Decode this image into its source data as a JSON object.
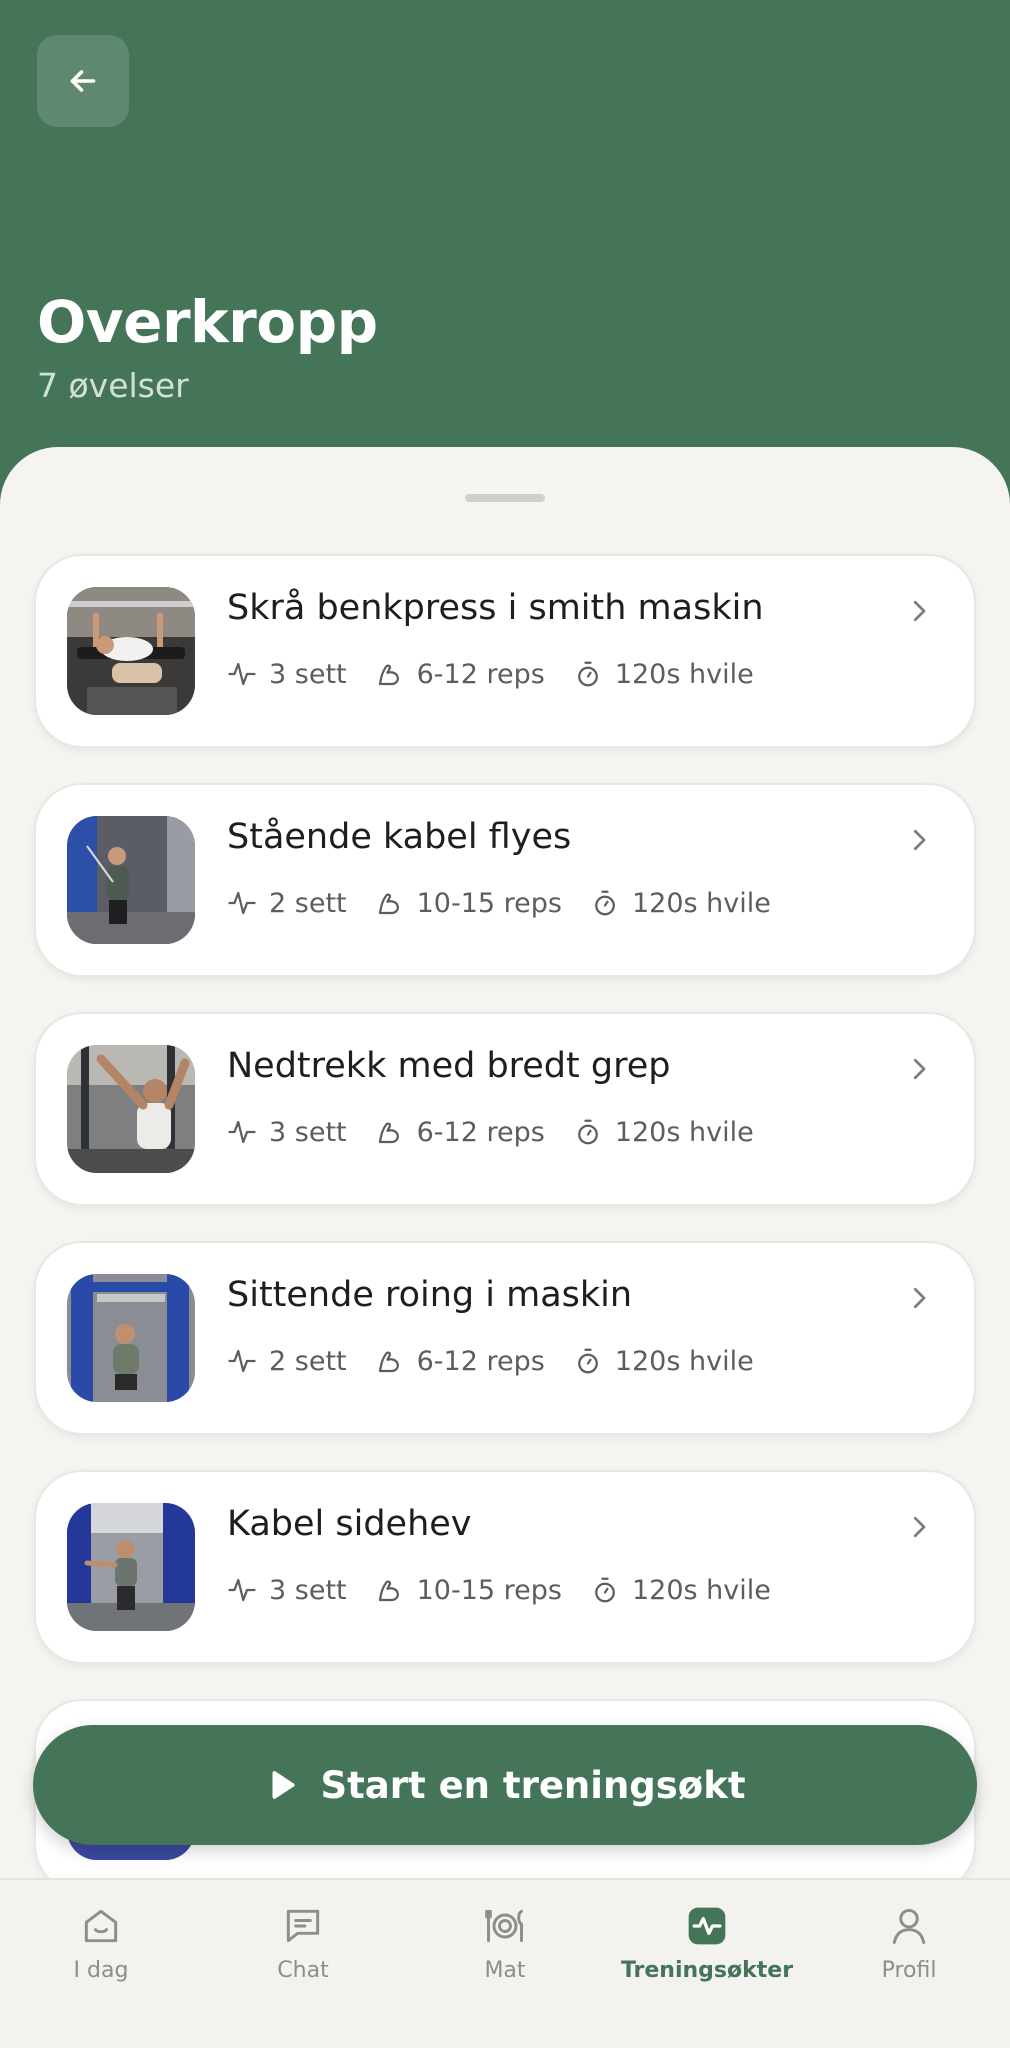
{
  "header": {
    "title": "Overkropp",
    "subtitle": "7 øvelser"
  },
  "exercises": [
    {
      "name": "Skrå benkpress i smith maskin",
      "sets": "3 sett",
      "reps": "6-12 reps",
      "rest": "120s hvile"
    },
    {
      "name": "Stående kabel flyes",
      "sets": "2 sett",
      "reps": "10-15 reps",
      "rest": "120s hvile"
    },
    {
      "name": "Nedtrekk med bredt grep",
      "sets": "3 sett",
      "reps": "6-12 reps",
      "rest": "120s hvile"
    },
    {
      "name": "Sittende roing i maskin",
      "sets": "2 sett",
      "reps": "6-12 reps",
      "rest": "120s hvile"
    },
    {
      "name": "Kabel sidehev",
      "sets": "3 sett",
      "reps": "10-15 reps",
      "rest": "120s hvile"
    }
  ],
  "start_button": {
    "label": "Start en treningsøkt"
  },
  "tabs": [
    {
      "label": "I dag",
      "icon": "home-icon"
    },
    {
      "label": "Chat",
      "icon": "chat-icon"
    },
    {
      "label": "Mat",
      "icon": "plate-icon"
    },
    {
      "label": "Treningsøkter",
      "icon": "activity-icon",
      "active": true
    },
    {
      "label": "Profil",
      "icon": "person-icon"
    }
  ],
  "colors": {
    "brand": "#457559",
    "sheet": "#f5f4f1",
    "tab_active": "#457559",
    "tab_inactive": "#8b8e8b"
  }
}
